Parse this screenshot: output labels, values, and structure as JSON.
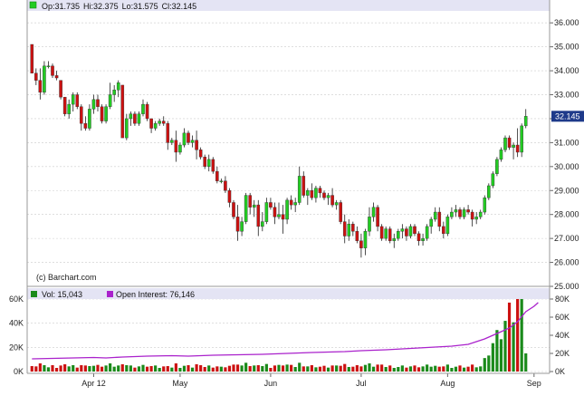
{
  "chart_data": [
    {
      "type": "candlestick",
      "header": {
        "open_label": "Op:31.735",
        "high_label": "Hi:32.375",
        "low_label": "Lo:31.575",
        "close_label": "Cl:32.145"
      },
      "watermark": "(c) Barchart.com",
      "last_price_label": "32.145",
      "ylim": [
        25.0,
        36.5
      ],
      "y_ticks": [
        "36.000",
        "35.000",
        "34.000",
        "33.000",
        "32.000",
        "31.000",
        "30.000",
        "29.000",
        "28.000",
        "27.000",
        "26.000",
        "25.000"
      ],
      "x_tick_labels": [
        "Apr 12",
        "May",
        "Jun",
        "Jul",
        "Aug",
        "Sep"
      ],
      "x_tick_positions": [
        15,
        36,
        58,
        80,
        101,
        122
      ],
      "bars": [
        [
          35.1,
          35.1,
          33.9,
          33.9
        ],
        [
          33.9,
          34.1,
          33.4,
          33.6
        ],
        [
          33.6,
          34.1,
          32.8,
          33.1
        ],
        [
          33.1,
          34.4,
          33.0,
          34.2
        ],
        [
          34.2,
          34.4,
          34.1,
          34.2
        ],
        [
          34.2,
          34.3,
          33.7,
          33.8
        ],
        [
          33.8,
          34.0,
          33.6,
          33.7
        ],
        [
          33.6,
          33.6,
          32.8,
          32.9
        ],
        [
          32.9,
          32.9,
          32.1,
          32.2
        ],
        [
          32.2,
          32.8,
          32.0,
          32.6
        ],
        [
          32.6,
          33.1,
          32.3,
          33.0
        ],
        [
          33.0,
          33.1,
          32.4,
          32.5
        ],
        [
          32.5,
          32.6,
          31.5,
          31.8
        ],
        [
          31.8,
          32.1,
          31.5,
          31.6
        ],
        [
          31.6,
          32.6,
          31.5,
          32.4
        ],
        [
          32.4,
          33.0,
          32.2,
          32.8
        ],
        [
          32.8,
          33.0,
          32.3,
          32.5
        ],
        [
          32.5,
          32.6,
          31.8,
          31.9
        ],
        [
          31.9,
          32.6,
          31.8,
          32.5
        ],
        [
          32.5,
          33.5,
          32.4,
          33.0
        ],
        [
          33.0,
          33.4,
          32.7,
          33.2
        ],
        [
          33.2,
          33.6,
          32.9,
          33.5
        ],
        [
          33.4,
          33.4,
          31.6,
          31.2
        ],
        [
          31.2,
          32.2,
          31.1,
          32.0
        ],
        [
          32.0,
          32.3,
          31.7,
          32.2
        ],
        [
          32.2,
          32.3,
          31.7,
          31.8
        ],
        [
          31.8,
          32.3,
          31.7,
          32.2
        ],
        [
          32.2,
          32.8,
          32.1,
          32.6
        ],
        [
          32.6,
          32.7,
          31.9,
          32.0
        ],
        [
          32.0,
          32.0,
          31.4,
          31.6
        ],
        [
          31.6,
          31.9,
          31.5,
          31.8
        ],
        [
          31.8,
          32.0,
          31.7,
          31.9
        ],
        [
          31.9,
          32.1,
          31.7,
          31.8
        ],
        [
          31.8,
          31.9,
          30.7,
          31.0
        ],
        [
          31.0,
          31.2,
          30.9,
          31.1
        ],
        [
          31.1,
          31.5,
          30.2,
          30.6
        ],
        [
          30.6,
          31.0,
          30.5,
          30.9
        ],
        [
          30.9,
          31.6,
          30.8,
          31.4
        ],
        [
          31.4,
          31.5,
          30.9,
          31.0
        ],
        [
          31.0,
          31.3,
          30.8,
          31.1
        ],
        [
          31.1,
          31.5,
          30.3,
          30.7
        ],
        [
          30.7,
          30.8,
          30.3,
          30.4
        ],
        [
          30.4,
          30.5,
          29.9,
          30.0
        ],
        [
          30.0,
          30.5,
          29.8,
          30.3
        ],
        [
          30.3,
          30.4,
          29.7,
          29.8
        ],
        [
          29.8,
          30.0,
          29.3,
          29.4
        ],
        [
          29.4,
          29.5,
          29.3,
          29.4
        ],
        [
          29.4,
          29.6,
          28.9,
          29.0
        ],
        [
          29.0,
          29.1,
          28.3,
          28.5
        ],
        [
          28.5,
          28.6,
          27.8,
          27.9
        ],
        [
          27.9,
          28.4,
          26.9,
          27.3
        ],
        [
          27.3,
          27.9,
          27.1,
          27.7
        ],
        [
          27.7,
          28.9,
          27.6,
          28.8
        ],
        [
          28.8,
          28.9,
          28.0,
          28.3
        ],
        [
          28.3,
          28.6,
          27.9,
          28.4
        ],
        [
          28.4,
          28.6,
          27.1,
          27.5
        ],
        [
          27.5,
          28.1,
          27.3,
          27.7
        ],
        [
          27.7,
          28.7,
          27.6,
          28.5
        ],
        [
          28.5,
          28.7,
          28.2,
          28.3
        ],
        [
          28.3,
          28.5,
          27.6,
          27.9
        ],
        [
          27.9,
          28.5,
          27.8,
          28.0
        ],
        [
          28.0,
          28.4,
          27.2,
          27.8
        ],
        [
          27.8,
          28.7,
          27.6,
          28.6
        ],
        [
          28.6,
          28.8,
          28.2,
          28.4
        ],
        [
          28.4,
          28.7,
          28.1,
          28.5
        ],
        [
          28.5,
          30.0,
          28.4,
          29.6
        ],
        [
          29.6,
          29.8,
          28.7,
          28.8
        ],
        [
          28.8,
          29.1,
          28.4,
          29.0
        ],
        [
          29.0,
          29.3,
          28.6,
          28.7
        ],
        [
          28.7,
          29.2,
          28.5,
          29.1
        ],
        [
          29.1,
          29.2,
          28.7,
          28.9
        ],
        [
          28.9,
          29.0,
          28.6,
          28.7
        ],
        [
          28.7,
          28.9,
          28.4,
          28.8
        ],
        [
          28.8,
          29.1,
          28.3,
          28.4
        ],
        [
          28.4,
          28.6,
          28.2,
          28.5
        ],
        [
          28.5,
          28.6,
          27.6,
          27.7
        ],
        [
          27.7,
          28.0,
          26.8,
          27.1
        ],
        [
          27.1,
          27.8,
          26.9,
          27.6
        ],
        [
          27.6,
          27.7,
          27.1,
          27.3
        ],
        [
          27.3,
          27.5,
          26.8,
          26.9
        ],
        [
          26.9,
          27.2,
          26.2,
          26.6
        ],
        [
          26.6,
          27.4,
          26.3,
          27.3
        ],
        [
          27.3,
          28.3,
          27.1,
          27.9
        ],
        [
          27.9,
          28.5,
          27.7,
          28.3
        ],
        [
          28.3,
          28.4,
          27.3,
          27.5
        ],
        [
          27.5,
          27.6,
          26.9,
          27.0
        ],
        [
          27.0,
          27.5,
          26.9,
          27.4
        ],
        [
          27.4,
          27.5,
          26.8,
          26.9
        ],
        [
          26.9,
          27.2,
          26.6,
          27.0
        ],
        [
          27.0,
          27.4,
          26.9,
          27.3
        ],
        [
          27.3,
          27.6,
          27.0,
          27.4
        ],
        [
          27.4,
          27.5,
          26.9,
          27.1
        ],
        [
          27.1,
          27.6,
          27.0,
          27.5
        ],
        [
          27.5,
          27.6,
          27.1,
          27.2
        ],
        [
          27.2,
          27.3,
          26.7,
          26.9
        ],
        [
          26.9,
          27.2,
          26.7,
          27.0
        ],
        [
          27.0,
          27.6,
          26.9,
          27.5
        ],
        [
          27.5,
          27.9,
          27.2,
          27.8
        ],
        [
          27.8,
          28.3,
          27.7,
          28.1
        ],
        [
          28.1,
          28.3,
          27.3,
          27.5
        ],
        [
          27.5,
          27.7,
          27.0,
          27.2
        ],
        [
          27.2,
          28.0,
          27.1,
          27.9
        ],
        [
          27.9,
          28.3,
          27.8,
          28.1
        ],
        [
          28.1,
          28.4,
          27.9,
          28.2
        ],
        [
          28.2,
          28.3,
          27.8,
          27.9
        ],
        [
          27.9,
          28.3,
          27.8,
          28.2
        ],
        [
          28.2,
          28.4,
          28.0,
          28.1
        ],
        [
          28.1,
          28.2,
          27.5,
          27.8
        ],
        [
          27.8,
          28.1,
          27.6,
          27.9
        ],
        [
          27.9,
          28.2,
          27.8,
          28.1
        ],
        [
          28.1,
          28.8,
          28.0,
          28.7
        ],
        [
          28.7,
          29.3,
          28.6,
          29.2
        ],
        [
          29.2,
          29.8,
          29.1,
          29.7
        ],
        [
          29.7,
          30.4,
          29.6,
          30.3
        ],
        [
          30.3,
          30.8,
          30.2,
          30.7
        ],
        [
          30.7,
          31.3,
          30.6,
          31.2
        ],
        [
          31.2,
          31.3,
          30.7,
          30.8
        ],
        [
          30.8,
          31.0,
          30.3,
          30.9
        ],
        [
          30.9,
          31.6,
          30.4,
          30.6
        ],
        [
          30.6,
          31.8,
          30.4,
          31.7
        ],
        [
          31.7,
          32.4,
          31.6,
          32.1
        ]
      ],
      "volume_panel": {
        "vol_label": "Vol: 15,043",
        "oi_label": "Open Interest: 76,146",
        "left_ticks": [
          "60K",
          "40K",
          "20K",
          "0K"
        ],
        "right_ticks": [
          "80K",
          "60K",
          "40K",
          "20K",
          "0K"
        ],
        "left_max": 60000,
        "right_max": 80000,
        "volume_color_up": "#1a8a1a",
        "volume_color_down": "#cc1111",
        "oi_color": "#aa22cc",
        "oi_points": [
          [
            0,
            14000
          ],
          [
            5,
            14500
          ],
          [
            10,
            15000
          ],
          [
            15,
            15500
          ],
          [
            18,
            15000
          ],
          [
            22,
            16000
          ],
          [
            28,
            17000
          ],
          [
            34,
            17500
          ],
          [
            38,
            17000
          ],
          [
            44,
            18000
          ],
          [
            50,
            18500
          ],
          [
            56,
            19000
          ],
          [
            62,
            20000
          ],
          [
            68,
            21000
          ],
          [
            72,
            21500
          ],
          [
            76,
            22000
          ],
          [
            80,
            23000
          ],
          [
            86,
            24000
          ],
          [
            90,
            25000
          ],
          [
            94,
            26000
          ],
          [
            98,
            27000
          ],
          [
            102,
            28000
          ],
          [
            106,
            30000
          ],
          [
            108,
            33000
          ],
          [
            110,
            36000
          ],
          [
            112,
            40000
          ],
          [
            114,
            44000
          ],
          [
            116,
            48000
          ],
          [
            118,
            55000
          ],
          [
            120,
            66000
          ],
          [
            122,
            72000
          ],
          [
            123,
            76146
          ]
        ]
      },
      "colors": {
        "up": "#22cc22",
        "down": "#cc1111",
        "header_band": "#e4e4f4",
        "grid": "#cccccc",
        "price_box": "#1e3a8a"
      }
    }
  ]
}
